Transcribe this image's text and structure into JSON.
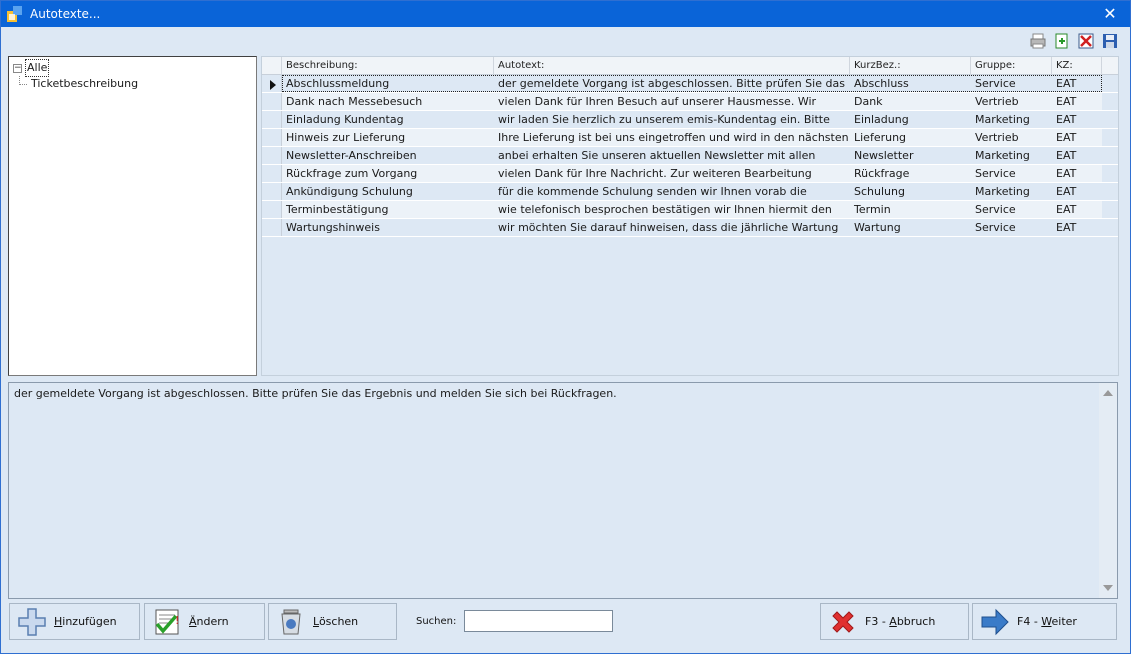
{
  "window": {
    "title": "Autotexte..."
  },
  "tree": {
    "root": "Alle",
    "root_expander": "−",
    "children": [
      "Ticketbeschreibung"
    ]
  },
  "grid": {
    "columns": [
      "Beschreibung:",
      "Autotext:",
      "KurzBez.:",
      "Gruppe:",
      "KZ:"
    ],
    "rows": [
      [
        "Abschlussmeldung",
        "der gemeldete Vorgang ist abgeschlossen. Bitte prüfen Sie das",
        "Abschluss",
        "Service",
        "EAT"
      ],
      [
        "Dank nach Messebesuch",
        "vielen Dank für Ihren Besuch auf unserer Hausmesse. Wir",
        "Dank",
        "Vertrieb",
        "EAT"
      ],
      [
        "Einladung Kundentag",
        "wir laden Sie herzlich zu unserem emis-Kundentag ein. Bitte",
        "Einladung",
        "Marketing",
        "EAT"
      ],
      [
        "Hinweis zur Lieferung",
        "Ihre Lieferung ist bei uns eingetroffen und wird in den nächsten",
        "Lieferung",
        "Vertrieb",
        "EAT"
      ],
      [
        "Newsletter-Anschreiben",
        "anbei erhalten Sie unseren aktuellen Newsletter mit allen",
        "Newsletter",
        "Marketing",
        "EAT"
      ],
      [
        "Rückfrage zum Vorgang",
        "vielen Dank für Ihre Nachricht. Zur weiteren Bearbeitung",
        "Rückfrage",
        "Service",
        "EAT"
      ],
      [
        "Ankündigung Schulung",
        "für die kommende Schulung senden wir Ihnen vorab die",
        "Schulung",
        "Marketing",
        "EAT"
      ],
      [
        "Terminbestätigung",
        "wie telefonisch besprochen bestätigen wir Ihnen hiermit den",
        "Termin",
        "Service",
        "EAT"
      ],
      [
        "Wartungshinweis",
        "wir möchten Sie darauf hinweisen, dass die jährliche Wartung",
        "Wartung",
        "Service",
        "EAT"
      ]
    ]
  },
  "preview": {
    "text": "der gemeldete Vorgang ist abgeschlossen. Bitte prüfen Sie das Ergebnis und melden Sie sich bei Rückfragen."
  },
  "buttons": {
    "add": {
      "first": "H",
      "rest": "inzufügen"
    },
    "edit": {
      "first": "Ä",
      "rest": "ndern"
    },
    "delete": {
      "first": "L",
      "rest": "öschen"
    },
    "cancel": {
      "prefix": "F3 - ",
      "first": "A",
      "rest": "bbruch"
    },
    "next": {
      "prefix": "F4 - ",
      "first": "W",
      "rest": "eiter"
    }
  },
  "search": {
    "label": "Suchen:",
    "value": ""
  },
  "titlebar": {
    "close_glyph": "✕"
  },
  "colors": {
    "title_bar": "#0a64d8",
    "panel": "#dde8f4",
    "accent_red": "#e03030",
    "accent_blue": "#3a7bc8"
  }
}
